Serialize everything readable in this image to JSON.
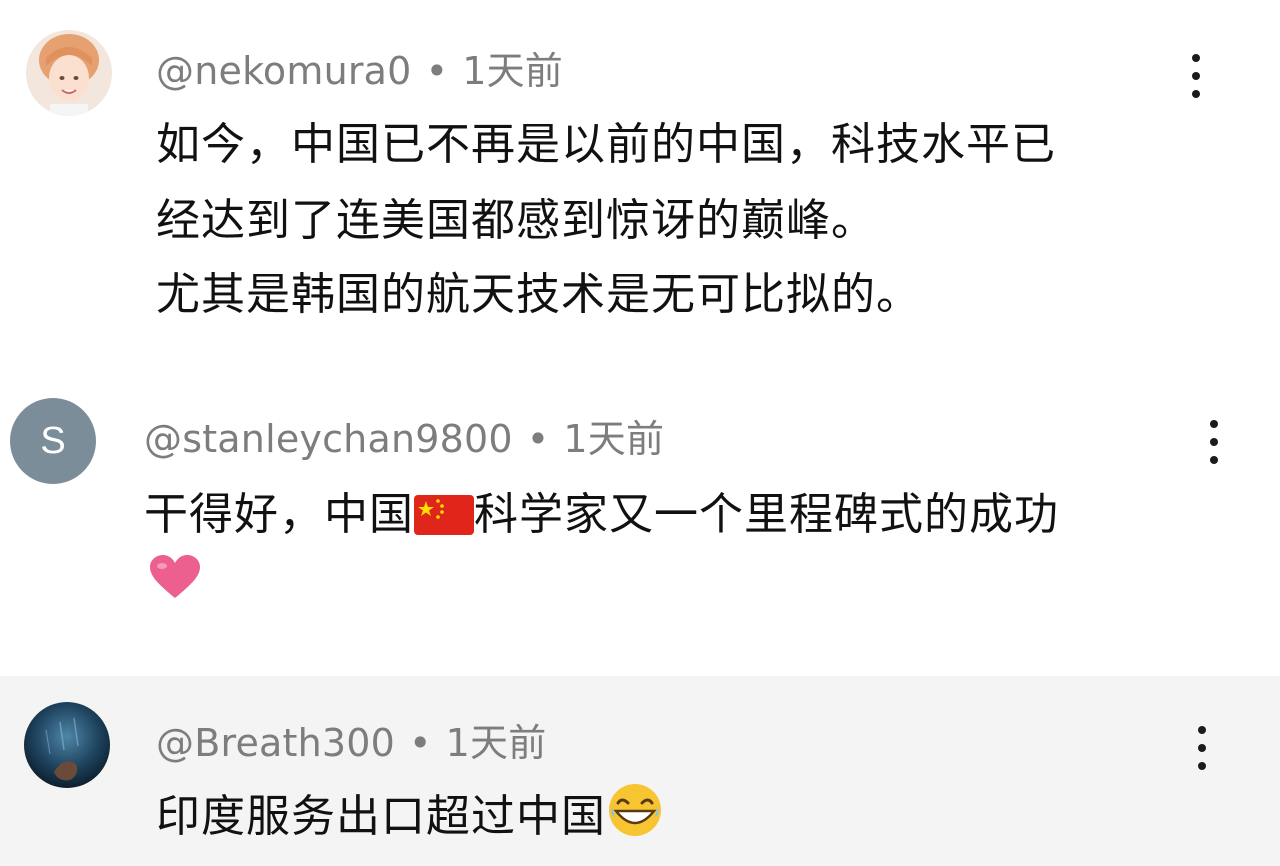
{
  "comments": [
    {
      "username": "@nekomura0",
      "separator": "•",
      "time": "1天前",
      "lines": [
        "如今，中国已不再是以前的中国，科技水平已",
        "经达到了连美国都感到惊讶的巅峰。",
        "尤其是韩国的航天技术是无可比拟的。"
      ],
      "avatar_icon": "woman-portrait-avatar"
    },
    {
      "username": "@stanleychan9800",
      "separator": "•",
      "time": "1天前",
      "line1_before_flag": "干得好，中国",
      "flag_icon": "china-flag-emoji",
      "line1_after_flag": "科学家又一个里程碑式的成功",
      "line2_icon": "pink-heart-emoji",
      "avatar_letter": "S",
      "avatar_color": "#7a8d99"
    },
    {
      "username": "@Breath300",
      "separator": "•",
      "time": "1天前",
      "line_text": "印度服务出口超过中国",
      "line_icon": "laughing-face-emoji",
      "avatar_icon": "dark-blue-photo-avatar"
    }
  ]
}
